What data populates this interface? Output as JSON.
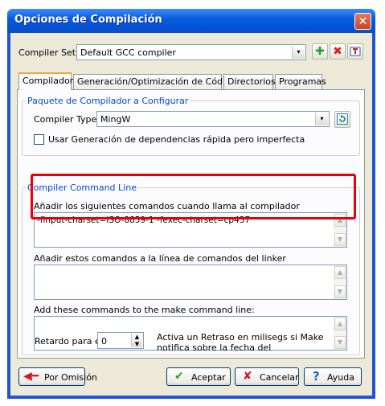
{
  "window": {
    "title": "Opciones de Compilación",
    "close_glyph": "✕"
  },
  "compiler_set": {
    "label": "Compiler Set :",
    "value": "Default GCC compiler",
    "dropdown_glyph": "▾"
  },
  "toolbar_icons": [
    "add-icon",
    "delete-icon",
    "rename-icon"
  ],
  "tabs": [
    {
      "label": "Compilador",
      "active": true
    },
    {
      "label": "Generación/Optimización de Código",
      "active": false
    },
    {
      "label": "Directorios",
      "active": false
    },
    {
      "label": "Programas",
      "active": false
    }
  ],
  "package_group": {
    "legend": "Paquete de Compilador a Configurar",
    "compiler_type_label": "Compiler Type:",
    "compiler_type_value": "MingW",
    "fast_deps_label": "Usar Generación de dependencias rápida pero imperfecta",
    "fast_deps_checked": false
  },
  "cmdline_group": {
    "legend": "Compiler Command Line",
    "compiler_label": "Añadir los siguientes comandos cuando llama al compilador",
    "compiler_value": "-finput-charset=ISO-8859-1 -fexec-charset=cp437",
    "linker_label": "Añadir estos comandos a la línea de comandos del linker",
    "linker_value": "",
    "make_label": "Add these commands to the make command line:",
    "make_value": ""
  },
  "delay": {
    "label": "Retardo para el",
    "value": "0",
    "description": "Activa un Retraso en milisegs si Make notifica sobre la fecha del"
  },
  "buttons": {
    "default": "Por Omisión",
    "accept": "Aceptar",
    "cancel": "Cancelar",
    "help": "Ayuda"
  },
  "colors": {
    "titlebar": "#0553d6",
    "accent_legend": "#0046d5",
    "highlight": "#e8000b",
    "dialog_bg": "#ece9d8"
  }
}
